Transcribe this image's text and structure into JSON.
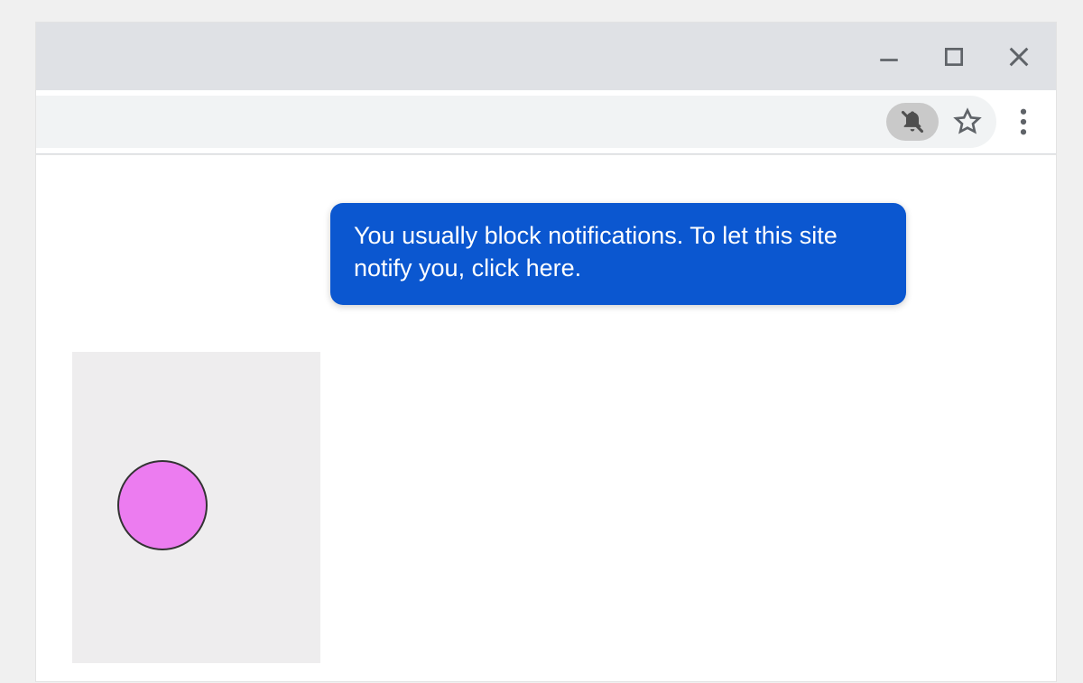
{
  "tooltip": {
    "message": "You usually block notifications. To let this site notify you, click here."
  },
  "icons": {
    "minimize": "minimize-icon",
    "maximize": "maximize-icon",
    "close": "close-icon",
    "bell_blocked": "bell-blocked-icon",
    "star": "star-icon",
    "overflow": "overflow-menu-icon"
  },
  "colors": {
    "tooltip_bg": "#0b57d0",
    "titlebar_bg": "#dfe1e5",
    "address_bar_bg": "#f1f3f4",
    "pink_circle": "#ec7cf0"
  }
}
